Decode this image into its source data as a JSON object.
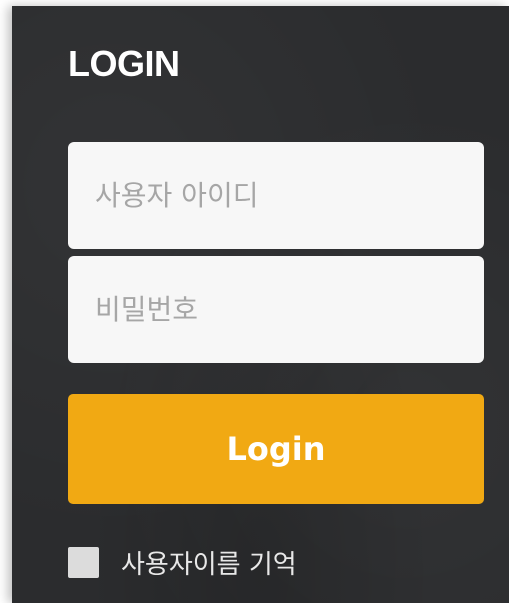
{
  "login_panel": {
    "title": "LOGIN",
    "username_placeholder": "사용자 아이디",
    "password_placeholder": "비밀번호",
    "login_button_label": "Login",
    "remember_label": "사용자이름 기억",
    "remember_checked": false
  },
  "colors": {
    "panel_background": "#2b2c2e",
    "accent": "#f1a913",
    "input_background": "#f7f7f7"
  }
}
